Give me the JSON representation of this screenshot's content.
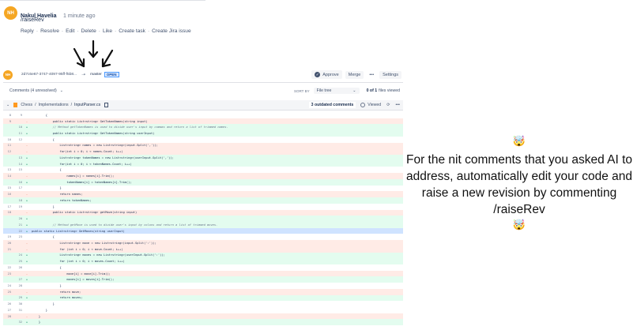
{
  "comment": {
    "avatar": "NH",
    "author": "Nakul Havelia",
    "time": "1 minute ago",
    "text": "/raiseRev",
    "actions": [
      "Reply",
      "Resolve",
      "Edit",
      "Delete",
      "Like",
      "Create task",
      "Create Jira issue"
    ]
  },
  "pr": {
    "avatar": "NH",
    "source_branch": "2d7c6e67-3747-4097-95ff-f5b8...",
    "target_branch": "master",
    "status": "OPEN",
    "buttons": {
      "approve": "Approve",
      "merge": "Merge",
      "more": "•••",
      "settings": "Settings"
    }
  },
  "toolbar": {
    "comments": "Comments (4 unresolved)",
    "sort_by": "SORT BY",
    "sort_value": "File tree",
    "files_viewed_count": "0 of 1",
    "files_viewed": "files viewed"
  },
  "file": {
    "breadcrumb": [
      "Chess",
      "Implementations",
      "InputParser.cs"
    ],
    "outdated": "3 outdated comments",
    "viewed": "Viewed"
  },
  "annotation": {
    "emoji_top": "🤯",
    "text": "For the nit comments that you asked AI to address, automatically edit your code and raise a new revision by commenting /raiseRev",
    "emoji_bottom": "🤯"
  },
  "diff": [
    {
      "old": "8",
      "new": "9",
      "type": "ctx",
      "code": "        {"
    },
    {
      "old": "9",
      "new": "",
      "type": "del",
      "code": "            public static List<string> GetTokenNames(string input)"
    },
    {
      "old": "",
      "new": "10",
      "type": "add",
      "code": "            // Method getTokenNames is used to divide user's input by commas and return a list of trimmed names."
    },
    {
      "old": "",
      "new": "11",
      "type": "add",
      "code": "            public static List<string> GetTokenNames(string userInput)"
    },
    {
      "old": "10",
      "new": "12",
      "type": "ctx",
      "code": "            {"
    },
    {
      "old": "11",
      "new": "",
      "type": "del",
      "code": "                List<string> names = new List<string>(input.Split(','));"
    },
    {
      "old": "12",
      "new": "",
      "type": "del",
      "code": "                for(int i = 0; i < names.Count; i++)"
    },
    {
      "old": "",
      "new": "13",
      "type": "add",
      "code": "                List<string> tokenNames = new List<string>(userInput.Split(','));"
    },
    {
      "old": "",
      "new": "14",
      "type": "add",
      "code": "                for(int i = 0; i < tokenNames.Count; i++)"
    },
    {
      "old": "13",
      "new": "15",
      "type": "ctx",
      "code": "                {"
    },
    {
      "old": "14",
      "new": "",
      "type": "del",
      "code": "                    names[i] = names[i].Trim();"
    },
    {
      "old": "",
      "new": "16",
      "type": "add",
      "code": "                    tokenNames[i] = tokenNames[i].Trim();"
    },
    {
      "old": "15",
      "new": "17",
      "type": "ctx",
      "code": "                }"
    },
    {
      "old": "16",
      "new": "",
      "type": "del",
      "code": "                return names;"
    },
    {
      "old": "",
      "new": "18",
      "type": "add",
      "code": "                return tokenNames;"
    },
    {
      "old": "17",
      "new": "19",
      "type": "ctx",
      "code": "            }"
    },
    {
      "old": "18",
      "new": "",
      "type": "del",
      "code": "            public static List<string> getMove(string input)"
    },
    {
      "old": "",
      "new": "20",
      "type": "add",
      "code": ""
    },
    {
      "old": "",
      "new": "21",
      "type": "add",
      "code": "            // Method getMove is used to divide user's input by colons and return a list of trimmed moves."
    },
    {
      "old": "",
      "new": "22",
      "type": "add",
      "code": "public static List<string> GetMoves(string userInput)"
    },
    {
      "old": "19",
      "new": "23",
      "type": "ctx",
      "code": "            {"
    },
    {
      "old": "20",
      "new": "",
      "type": "del",
      "code": "                List<string> move = new List<string>(input.Split(':'));"
    },
    {
      "old": "21",
      "new": "",
      "type": "del",
      "code": "                for (int i = 0; i < move.Count; i++)"
    },
    {
      "old": "",
      "new": "24",
      "type": "add",
      "code": "                List<string> moves = new List<string>(userInput.Split(':'));"
    },
    {
      "old": "",
      "new": "25",
      "type": "add",
      "code": "                for (int i = 0; i < moves.Count; i++)"
    },
    {
      "old": "22",
      "new": "26",
      "type": "ctx",
      "code": "                {"
    },
    {
      "old": "23",
      "new": "",
      "type": "del",
      "code": "                    move[i] = move[i].Trim();"
    },
    {
      "old": "",
      "new": "27",
      "type": "add",
      "code": "                    moves[i] = moves[i].Trim();"
    },
    {
      "old": "24",
      "new": "28",
      "type": "ctx",
      "code": "                }"
    },
    {
      "old": "25",
      "new": "",
      "type": "del",
      "code": "                return move;"
    },
    {
      "old": "",
      "new": "29",
      "type": "add",
      "code": "                return moves;"
    },
    {
      "old": "26",
      "new": "30",
      "type": "ctx",
      "code": "            }"
    },
    {
      "old": "27",
      "new": "31",
      "type": "ctx",
      "code": "        }"
    },
    {
      "old": "28",
      "new": "",
      "type": "del",
      "code": "    }"
    },
    {
      "old": "",
      "new": "32",
      "type": "add",
      "code": "    }"
    }
  ]
}
